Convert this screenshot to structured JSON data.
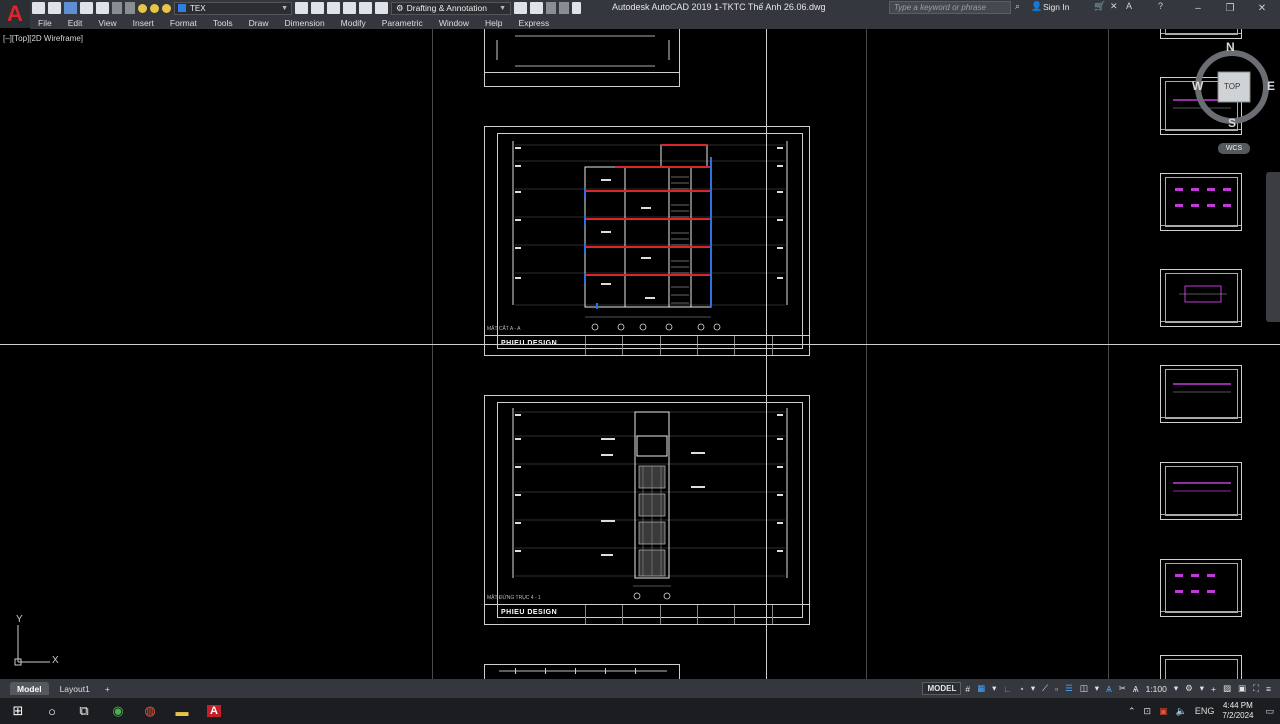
{
  "window": {
    "title": "Autodesk AutoCAD 2019    1-TKTC Thế Anh 26.06.dwg",
    "search_placeholder": "Type a keyword or phrase",
    "sign_in": "Sign In"
  },
  "toolbar": {
    "layer": "TEX",
    "workspace": "Drafting & Annotation"
  },
  "menu": [
    "File",
    "Edit",
    "View",
    "Insert",
    "Format",
    "Tools",
    "Draw",
    "Dimension",
    "Modify",
    "Parametric",
    "Window",
    "Help",
    "Express"
  ],
  "viewport": {
    "label": "[–][Top][2D Wireframe]",
    "viewcube": {
      "n": "N",
      "s": "S",
      "e": "E",
      "w": "W",
      "face": "TOP",
      "wcs": "WCS"
    },
    "ucs": {
      "x": "X",
      "y": "Y"
    }
  },
  "sheets": [
    {
      "caption": "MẶT CẮT A - A",
      "logo": "PHIEU DESIGN"
    },
    {
      "caption": "MẶT ĐỨNG TRỤC 4 - 1",
      "logo": "PHIEU DESIGN"
    }
  ],
  "tabs": [
    "Model",
    "Layout1",
    "+"
  ],
  "status": {
    "model": "MODEL",
    "scale": "1:100"
  },
  "taskbar": {
    "lang": "ENG",
    "time": "4:44 PM",
    "date": "7/2/2024"
  },
  "colors": {
    "accent": "#e0242c",
    "beam": "#d8262b",
    "column": "#2f6fe0",
    "background": "#000000"
  }
}
